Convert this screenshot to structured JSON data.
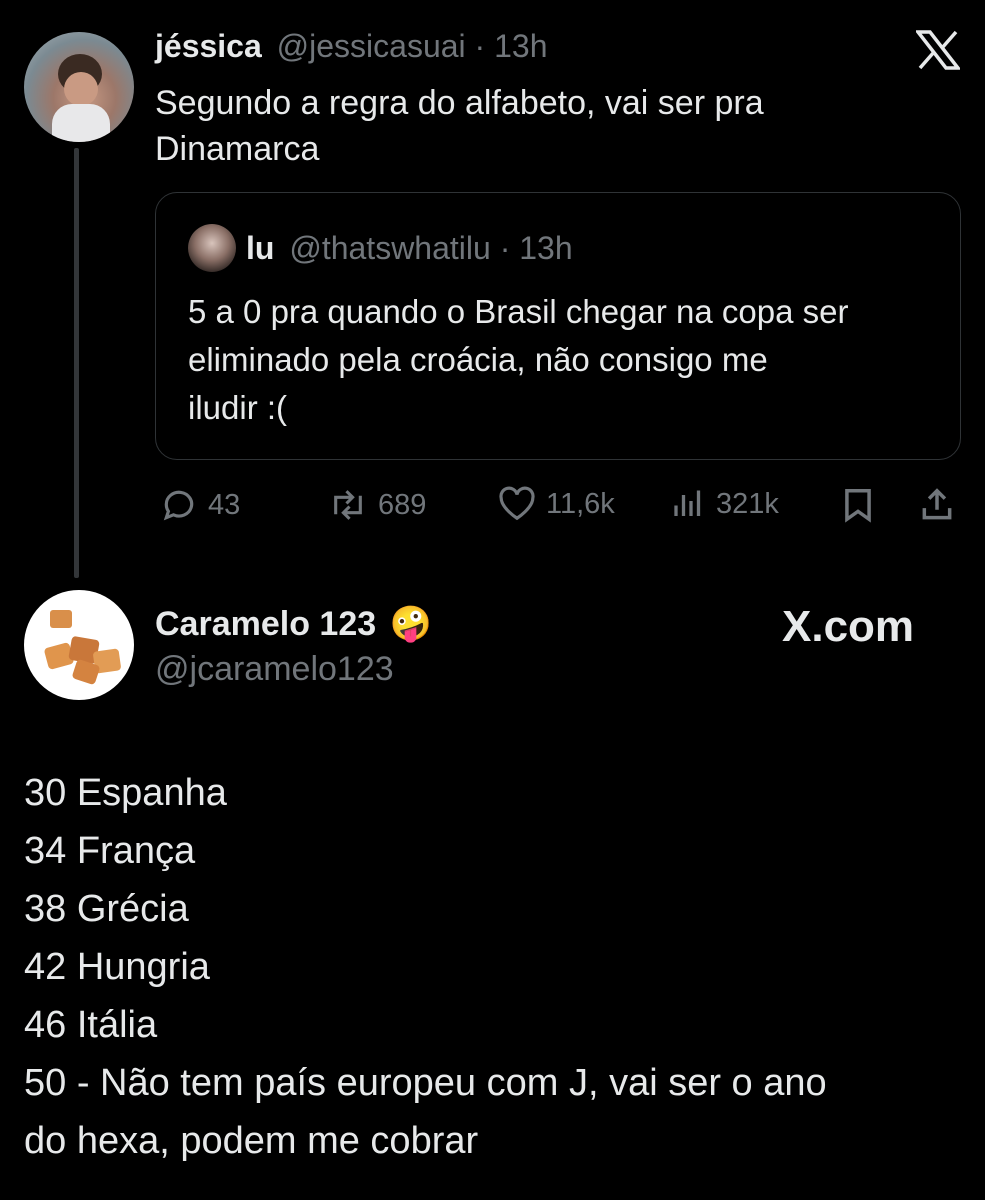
{
  "post": {
    "author_name": "jéssica",
    "author_handle": "@jessicasuai",
    "separator": "·",
    "time": "13h",
    "text_line1": "Segundo a regra do alfabeto, vai ser pra",
    "text_line2": "Dinamarca"
  },
  "quote": {
    "author_name": "lu",
    "author_handle": "@thatswhatilu",
    "separator": "·",
    "time": "13h",
    "text_line1": "5 a 0 pra quando o Brasil chegar na copa ser",
    "text_line2": "eliminado pela croácia,  não consigo me",
    "text_line3": "iludir :("
  },
  "actions": {
    "replies": "43",
    "reposts": "689",
    "likes": "11,6k",
    "views": "321k"
  },
  "reply_author": {
    "name": "Caramelo 123",
    "emoji": "🤪",
    "handle": "@jcaramelo123",
    "watermark": "X.com"
  },
  "reply_list": [
    "30 Espanha",
    "34 França",
    "38 Grécia",
    "42 Hungria",
    "46 Itália",
    "50 - Não tem país europeu com J, vai ser o ano",
    "do hexa, podem me cobrar"
  ],
  "colors": {
    "background": "#000000",
    "text": "#e7e9ea",
    "muted": "#71767b",
    "border": "#2f3336"
  },
  "icons": [
    "x-logo-icon",
    "reply-icon",
    "repost-icon",
    "like-icon",
    "views-icon",
    "bookmark-icon",
    "share-icon"
  ]
}
